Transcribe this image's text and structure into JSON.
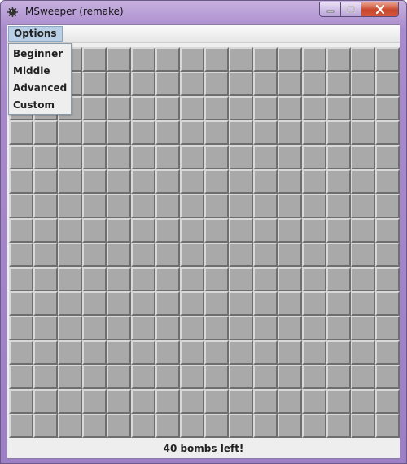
{
  "window": {
    "title": "MSweeper (remake)",
    "icon": "mine-icon",
    "controls": [
      "minimize-icon",
      "maximize-icon",
      "close-icon"
    ]
  },
  "menubar": {
    "options_label": "Options"
  },
  "options_menu": {
    "items": [
      {
        "label": "Beginner"
      },
      {
        "label": "Middle"
      },
      {
        "label": "Advanced"
      },
      {
        "label": "Custom"
      }
    ]
  },
  "board": {
    "rows": 16,
    "cols": 16,
    "cell_state": "unrevealed"
  },
  "status": {
    "text": "40 bombs left!"
  },
  "colors": {
    "frame": "#a98bcc",
    "cell": "#a9a9a9",
    "menu_highlight": "#b8cfe5",
    "close_button": "#c8452b"
  }
}
